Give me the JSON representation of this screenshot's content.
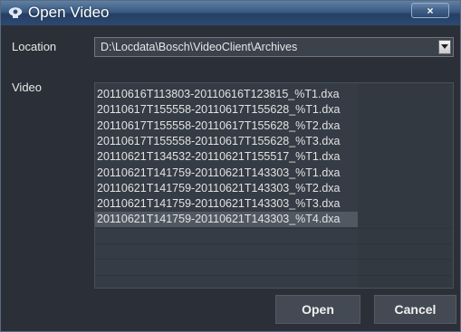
{
  "window": {
    "title": "Open Video",
    "close_label": "×"
  },
  "location": {
    "label": "Location",
    "value": "D:\\Locdata\\Bosch\\VideoClient\\Archives"
  },
  "video": {
    "label": "Video",
    "files": [
      "20110616T113803-20110616T123815_%T1.dxa",
      "20110617T155558-20110617T155628_%T1.dxa",
      "20110617T155558-20110617T155628_%T2.dxa",
      "20110617T155558-20110617T155628_%T3.dxa",
      "20110621T134532-20110621T155517_%T1.dxa",
      "20110621T141759-20110621T143303_%T1.dxa",
      "20110621T141759-20110621T143303_%T2.dxa",
      "20110621T141759-20110621T143303_%T3.dxa",
      "20110621T141759-20110621T143303_%T4.dxa"
    ],
    "selected_index": 8
  },
  "buttons": {
    "open": "Open",
    "cancel": "Cancel"
  },
  "colors": {
    "titlebar": "#3a5a82",
    "background": "#2b3038",
    "selection": "#505862"
  },
  "icons": {
    "title": "video-camera-icon",
    "dropdown": "chevron-down-icon"
  }
}
